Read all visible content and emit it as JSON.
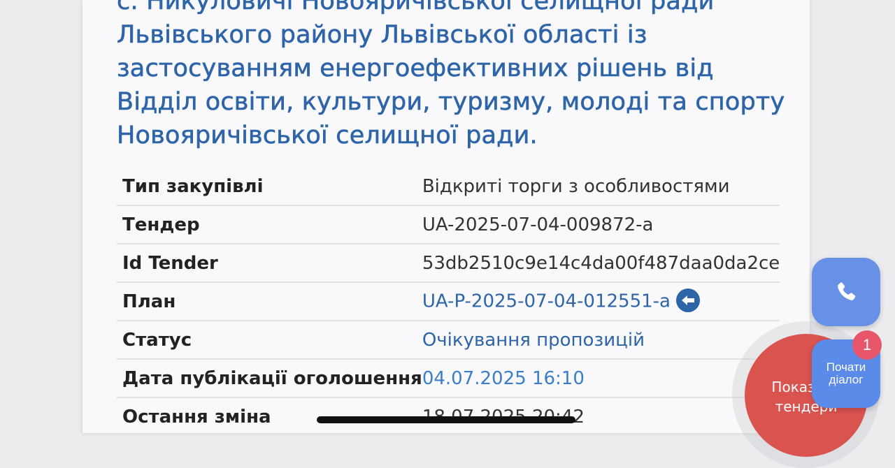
{
  "tender": {
    "title_lines": [
      "с. Никуловичі Новояричівської селищної ради",
      "Львівського району Львівської області із",
      "застосуванням енергоефективних рішень від",
      "Відділ освіти, культури, туризму, молоді та спорту",
      "Новояричівської селищної ради."
    ],
    "rows": [
      {
        "label": "Тип закупівлі",
        "value": "Відкриті торги з особливостями"
      },
      {
        "label": "Тендер",
        "value": "UA-2025-07-04-009872-a"
      },
      {
        "label": "Id Tender",
        "value": "53db2510c9e14c4da00f487daa0da2ce"
      },
      {
        "label": "План",
        "value": "UA-P-2025-07-04-012551-a"
      },
      {
        "label": "Статус",
        "value": "Очікування пропозицій"
      },
      {
        "label": "Дата публікації оголошення",
        "value": "04.07.2025 16:10"
      },
      {
        "label": "Остання зміна",
        "value": "18.07.2025 20:42"
      }
    ]
  },
  "floating": {
    "show_tenders_label": "Показати\nтендери",
    "dialog_label": "Почати\nдіалог",
    "badge_count": "1"
  },
  "icons": {
    "plan_link": "arrow-left-circle-icon",
    "call": "phone-icon"
  },
  "colors": {
    "link": "#2e64a8",
    "date": "#3b7ec7",
    "call_button": "#6691e6",
    "dialog_button": "#5a8be8",
    "badge": "#e8566b",
    "show_tenders": "#d9534f"
  }
}
